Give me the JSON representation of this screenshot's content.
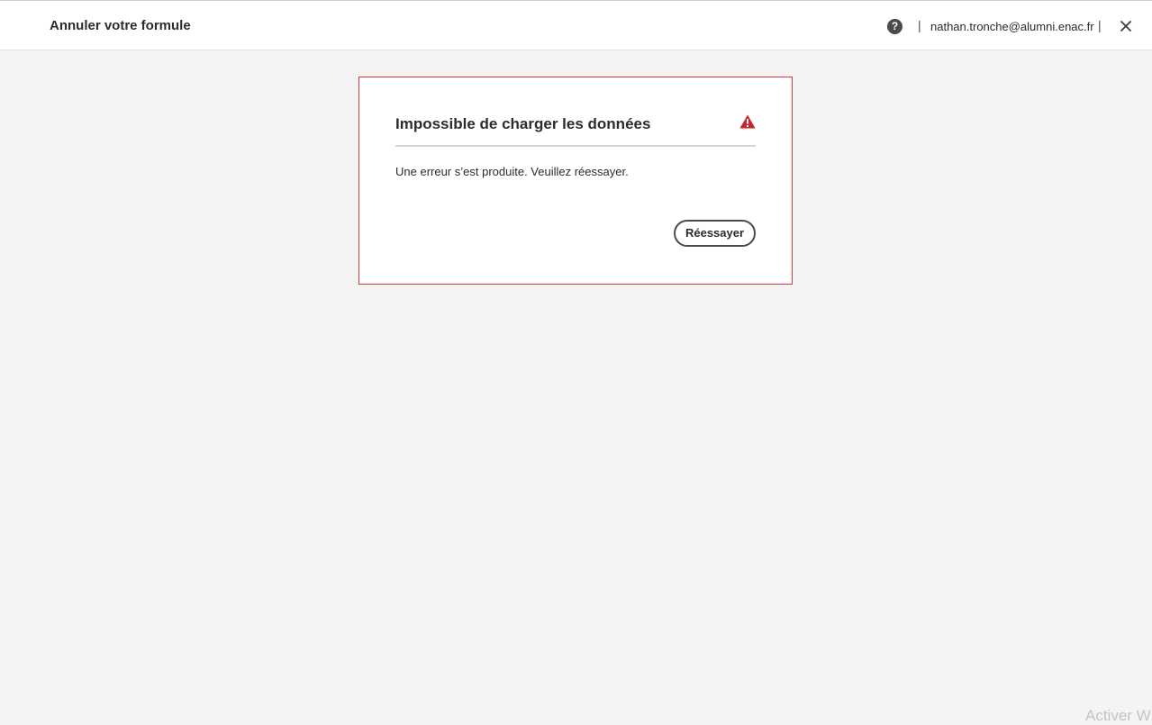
{
  "header": {
    "title": "Annuler votre formule",
    "help_icon": "help-circle-icon",
    "separator": "|",
    "user_email": "nathan.tronche@alumni.enac.fr",
    "close_icon": "close-icon"
  },
  "error_card": {
    "heading": "Impossible de charger les données",
    "alert_icon": "alert-triangle-icon",
    "message": "Une erreur s’est produite. Veuillez réessayer.",
    "retry_label": "Réessayer"
  },
  "watermark": {
    "text": "Activer W"
  },
  "colors": {
    "error_accent": "#d7373f",
    "alert_icon": "#c9252d",
    "text": "#2c2c2c",
    "background": "#f4f4f4"
  }
}
